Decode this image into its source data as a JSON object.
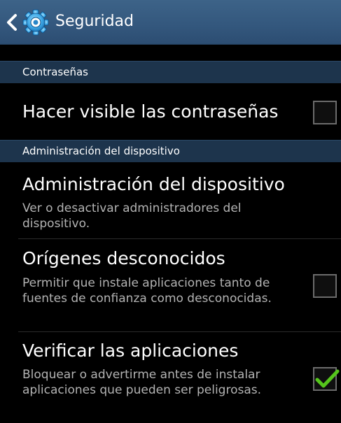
{
  "action_bar": {
    "title": "Seguridad",
    "back_icon": "chevron-left-icon",
    "app_icon": "gear-icon"
  },
  "sections": [
    {
      "header": "Contraseñas",
      "items": [
        {
          "title": "Hacer visible las contraseñas",
          "checked": false
        }
      ]
    },
    {
      "header": "Administración del dispositivo",
      "items": [
        {
          "title": "Administración del dispositivo",
          "subtitle": "Ver o desactivar administradores del dispositivo."
        },
        {
          "title": "Orígenes desconocidos",
          "subtitle": "Permitir que instale aplicaciones tanto de fuentes de confianza como desconocidas.",
          "checked": false
        },
        {
          "title": "Verificar las aplicaciones",
          "subtitle": "Bloquear o advertirme antes de instalar aplicaciones que pueden ser peligrosas.",
          "checked": true
        }
      ]
    }
  ],
  "colors": {
    "action_bar": "#34587e",
    "section_header": "#1d344c",
    "check_mark": "#55c61c",
    "subtitle_text": "#b3b3b3"
  }
}
